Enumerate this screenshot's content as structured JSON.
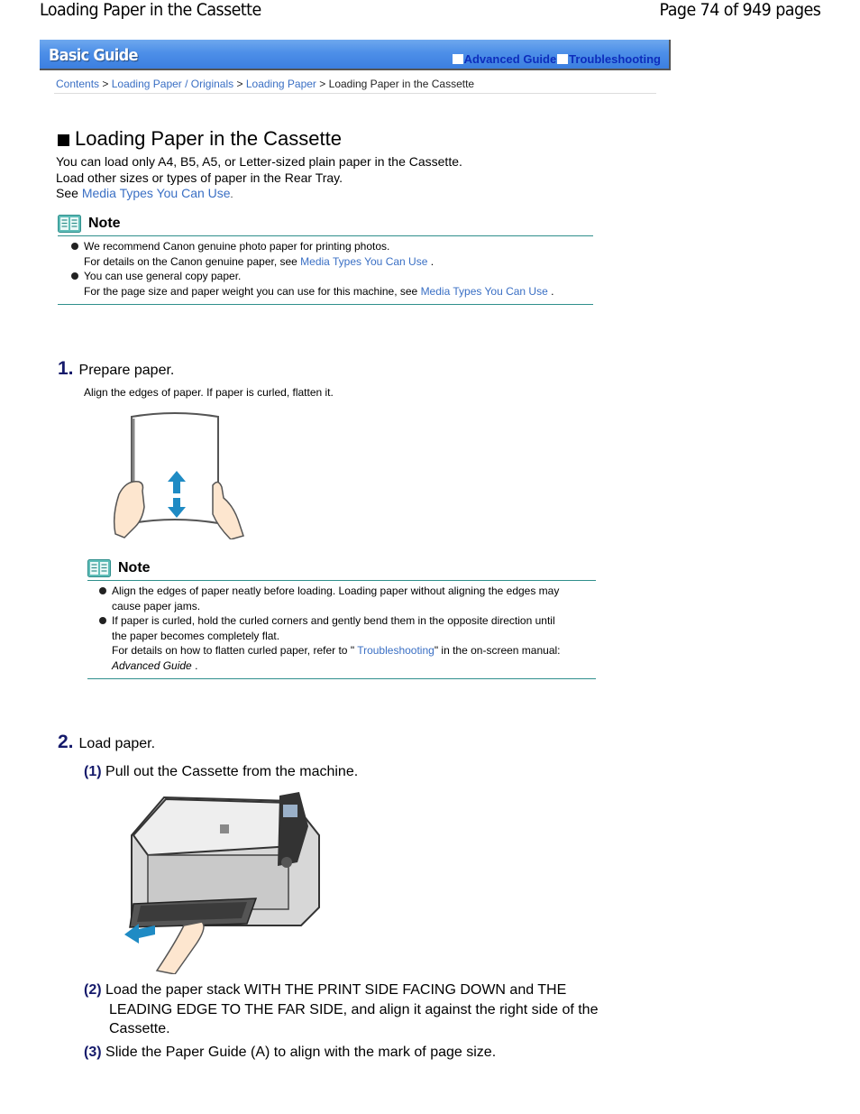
{
  "pdf_header": {
    "title": "Loading Paper in the Cassette",
    "page_indicator": "Page 74 of 949 pages"
  },
  "guide_bar": {
    "logo": "Basic Guide",
    "links": [
      {
        "label": "Advanced Guide"
      },
      {
        "label": "Troubleshooting"
      }
    ],
    "colors": {
      "bar": "#4d8fe8",
      "link": "#0d2dbd"
    }
  },
  "breadcrumb": {
    "items": [
      {
        "label": "Contents"
      },
      {
        "label": "Loading Paper / Originals"
      },
      {
        "label": "Loading Paper"
      }
    ],
    "separator": ">",
    "current": "Loading Paper in the Cassette"
  },
  "main": {
    "title": "Loading Paper in the Cassette",
    "intro_lines": [
      "You can load only A4, B5, A5, or Letter-sized plain paper in the Cassette.",
      "Load other sizes or types of paper in the Rear Tray."
    ],
    "see_prefix": "See ",
    "see_link": "Media Types You Can Use",
    "see_suffix": "."
  },
  "note1": {
    "heading": "Note",
    "items": [
      {
        "text": "We recommend Canon genuine photo paper for printing photos.",
        "detail_prefix": "For details on the Canon genuine paper, see ",
        "detail_link": "Media Types You Can Use",
        "detail_suffix": " ."
      },
      {
        "text": "You can use general copy paper.",
        "detail_prefix": "For the page size and paper weight you can use for this machine, see ",
        "detail_link": "Media Types You Can Use",
        "detail_suffix": " ."
      }
    ]
  },
  "step1": {
    "number": "1.",
    "title": "Prepare paper.",
    "description": "Align the edges of paper. If paper is curled, flatten it.",
    "illustration": "hands-holding-paper-with-up-down-arrows"
  },
  "note2": {
    "heading": "Note",
    "items": [
      {
        "line1": "Align the edges of paper neatly before loading. Loading paper without aligning the edges may",
        "line2": "cause paper jams."
      },
      {
        "line1": "If paper is curled, hold the curled corners and gently bend them in the opposite direction until",
        "line2": "the paper becomes completely flat.",
        "detail_prefix": "For details on how to flatten curled paper, refer to \" ",
        "detail_link": "Troubleshooting",
        "detail_suffix": "\" in the on-screen manual:",
        "detail_italic": "Advanced Guide",
        "detail_end": " ."
      }
    ]
  },
  "step2": {
    "number": "2.",
    "title": "Load paper.",
    "substeps": [
      {
        "number": "(1)",
        "lines": [
          "Pull out the Cassette from the machine."
        ]
      },
      {
        "number": "(2)",
        "lines": [
          "Load the paper stack WITH THE PRINT SIDE FACING DOWN and THE",
          "LEADING EDGE TO THE FAR SIDE, and align it against the right side of the",
          "Cassette."
        ]
      },
      {
        "number": "(3)",
        "lines": [
          "Slide the Paper Guide (A) to align with the mark of page size."
        ]
      }
    ],
    "illustration": "printer-with-cassette-pulled-out"
  }
}
